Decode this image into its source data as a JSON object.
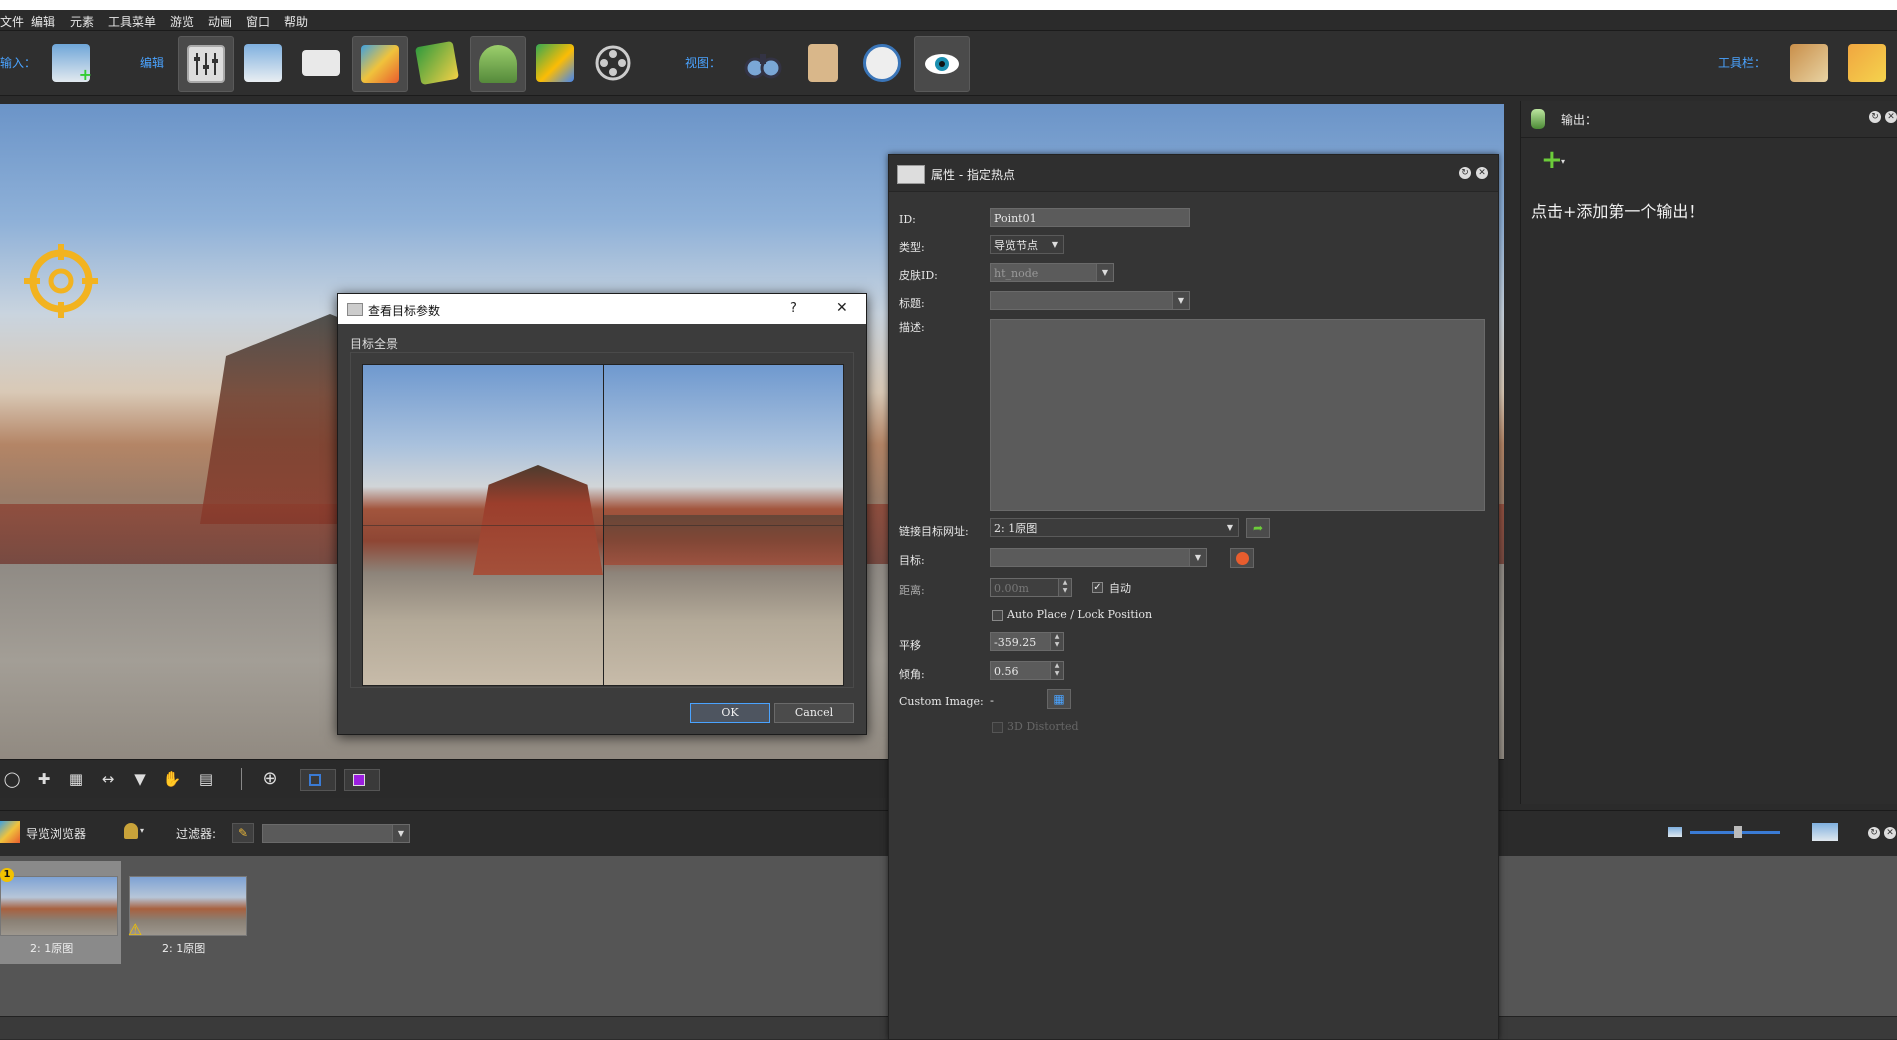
{
  "menu": {
    "items": [
      "文件",
      "编辑",
      "元素",
      "工具菜单",
      "游览",
      "动画",
      "窗口",
      "帮助"
    ]
  },
  "toolbar": {
    "input_label": "输入：",
    "edit_label": "编辑",
    "view_label": "视图：",
    "toolbar_label": "工具栏："
  },
  "output_panel": {
    "title": "输出：",
    "hint": "点击+添加第一个输出！"
  },
  "properties": {
    "title": "属性 - 指定热点",
    "id_label": "ID:",
    "id_value": "Point01",
    "type_label": "类型:",
    "type_value": "导览节点",
    "skin_label": "皮肤ID:",
    "skin_value": "ht_node",
    "title_label": "标题:",
    "title_value": "",
    "desc_label": "描述:",
    "link_label": "链接目标网址:",
    "link_value": "2: 1原图",
    "target_label": "目标:",
    "target_value": "",
    "distance_label": "距离:",
    "distance_value": "0.00m",
    "auto_label": "自动",
    "auto_checked": true,
    "autoplace_label": "Auto Place / Lock Position",
    "pan_label": "平移",
    "pan_value": "-359.25",
    "tilt_label": "倾角:",
    "tilt_value": "0.56",
    "custom_image_label": "Custom Image:",
    "custom_image_value": "-",
    "distorted_label": "3D Distorted"
  },
  "dialog": {
    "title": "查看目标参数",
    "help": "?",
    "close": "✕",
    "group_label": "目标全景",
    "ok": "OK",
    "cancel": "Cancel"
  },
  "tour_browser": {
    "title": "导览浏览器",
    "filter_label": "过滤器:",
    "filter_value": "",
    "nodes": [
      {
        "label": "2: 1原图",
        "badge": "1",
        "selected": true,
        "warning": false
      },
      {
        "label": "2: 1原图",
        "badge": "",
        "selected": false,
        "warning": true
      }
    ]
  },
  "colors": {
    "accent": "#4aa3ff",
    "panel": "#2d2d2d",
    "warning": "#f2c200"
  }
}
